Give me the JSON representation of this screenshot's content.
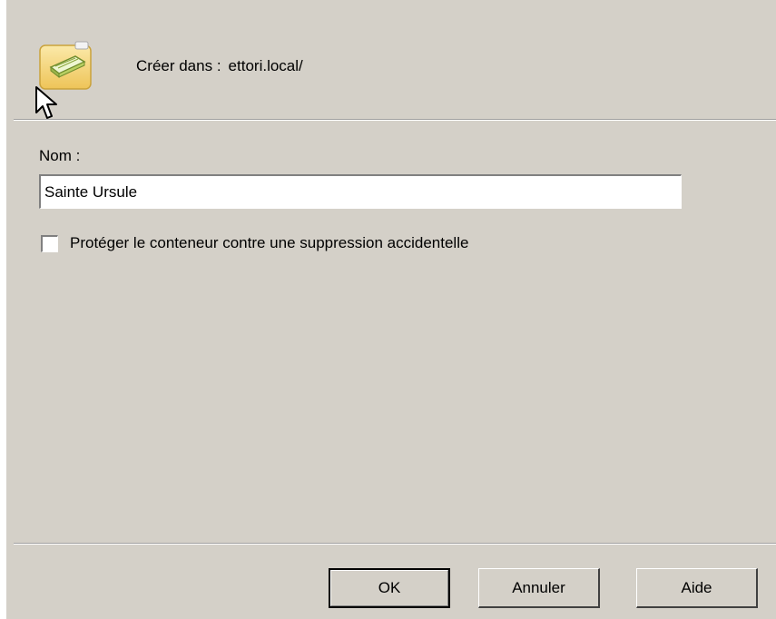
{
  "header": {
    "icon": "organizational-unit-folder-icon",
    "create_in_label": "Créer dans :",
    "create_in_path": "ettori.local/"
  },
  "form": {
    "name_label": "Nom :",
    "name_value": "Sainte Ursule",
    "protect_checkbox_label": "Protéger le conteneur contre une suppression accidentelle",
    "protect_checked": false
  },
  "buttons": {
    "ok": "OK",
    "cancel": "Annuler",
    "help": "Aide"
  },
  "colors": {
    "dialog_background": "#d4d0c8",
    "icon_folder": "#f5d272"
  }
}
